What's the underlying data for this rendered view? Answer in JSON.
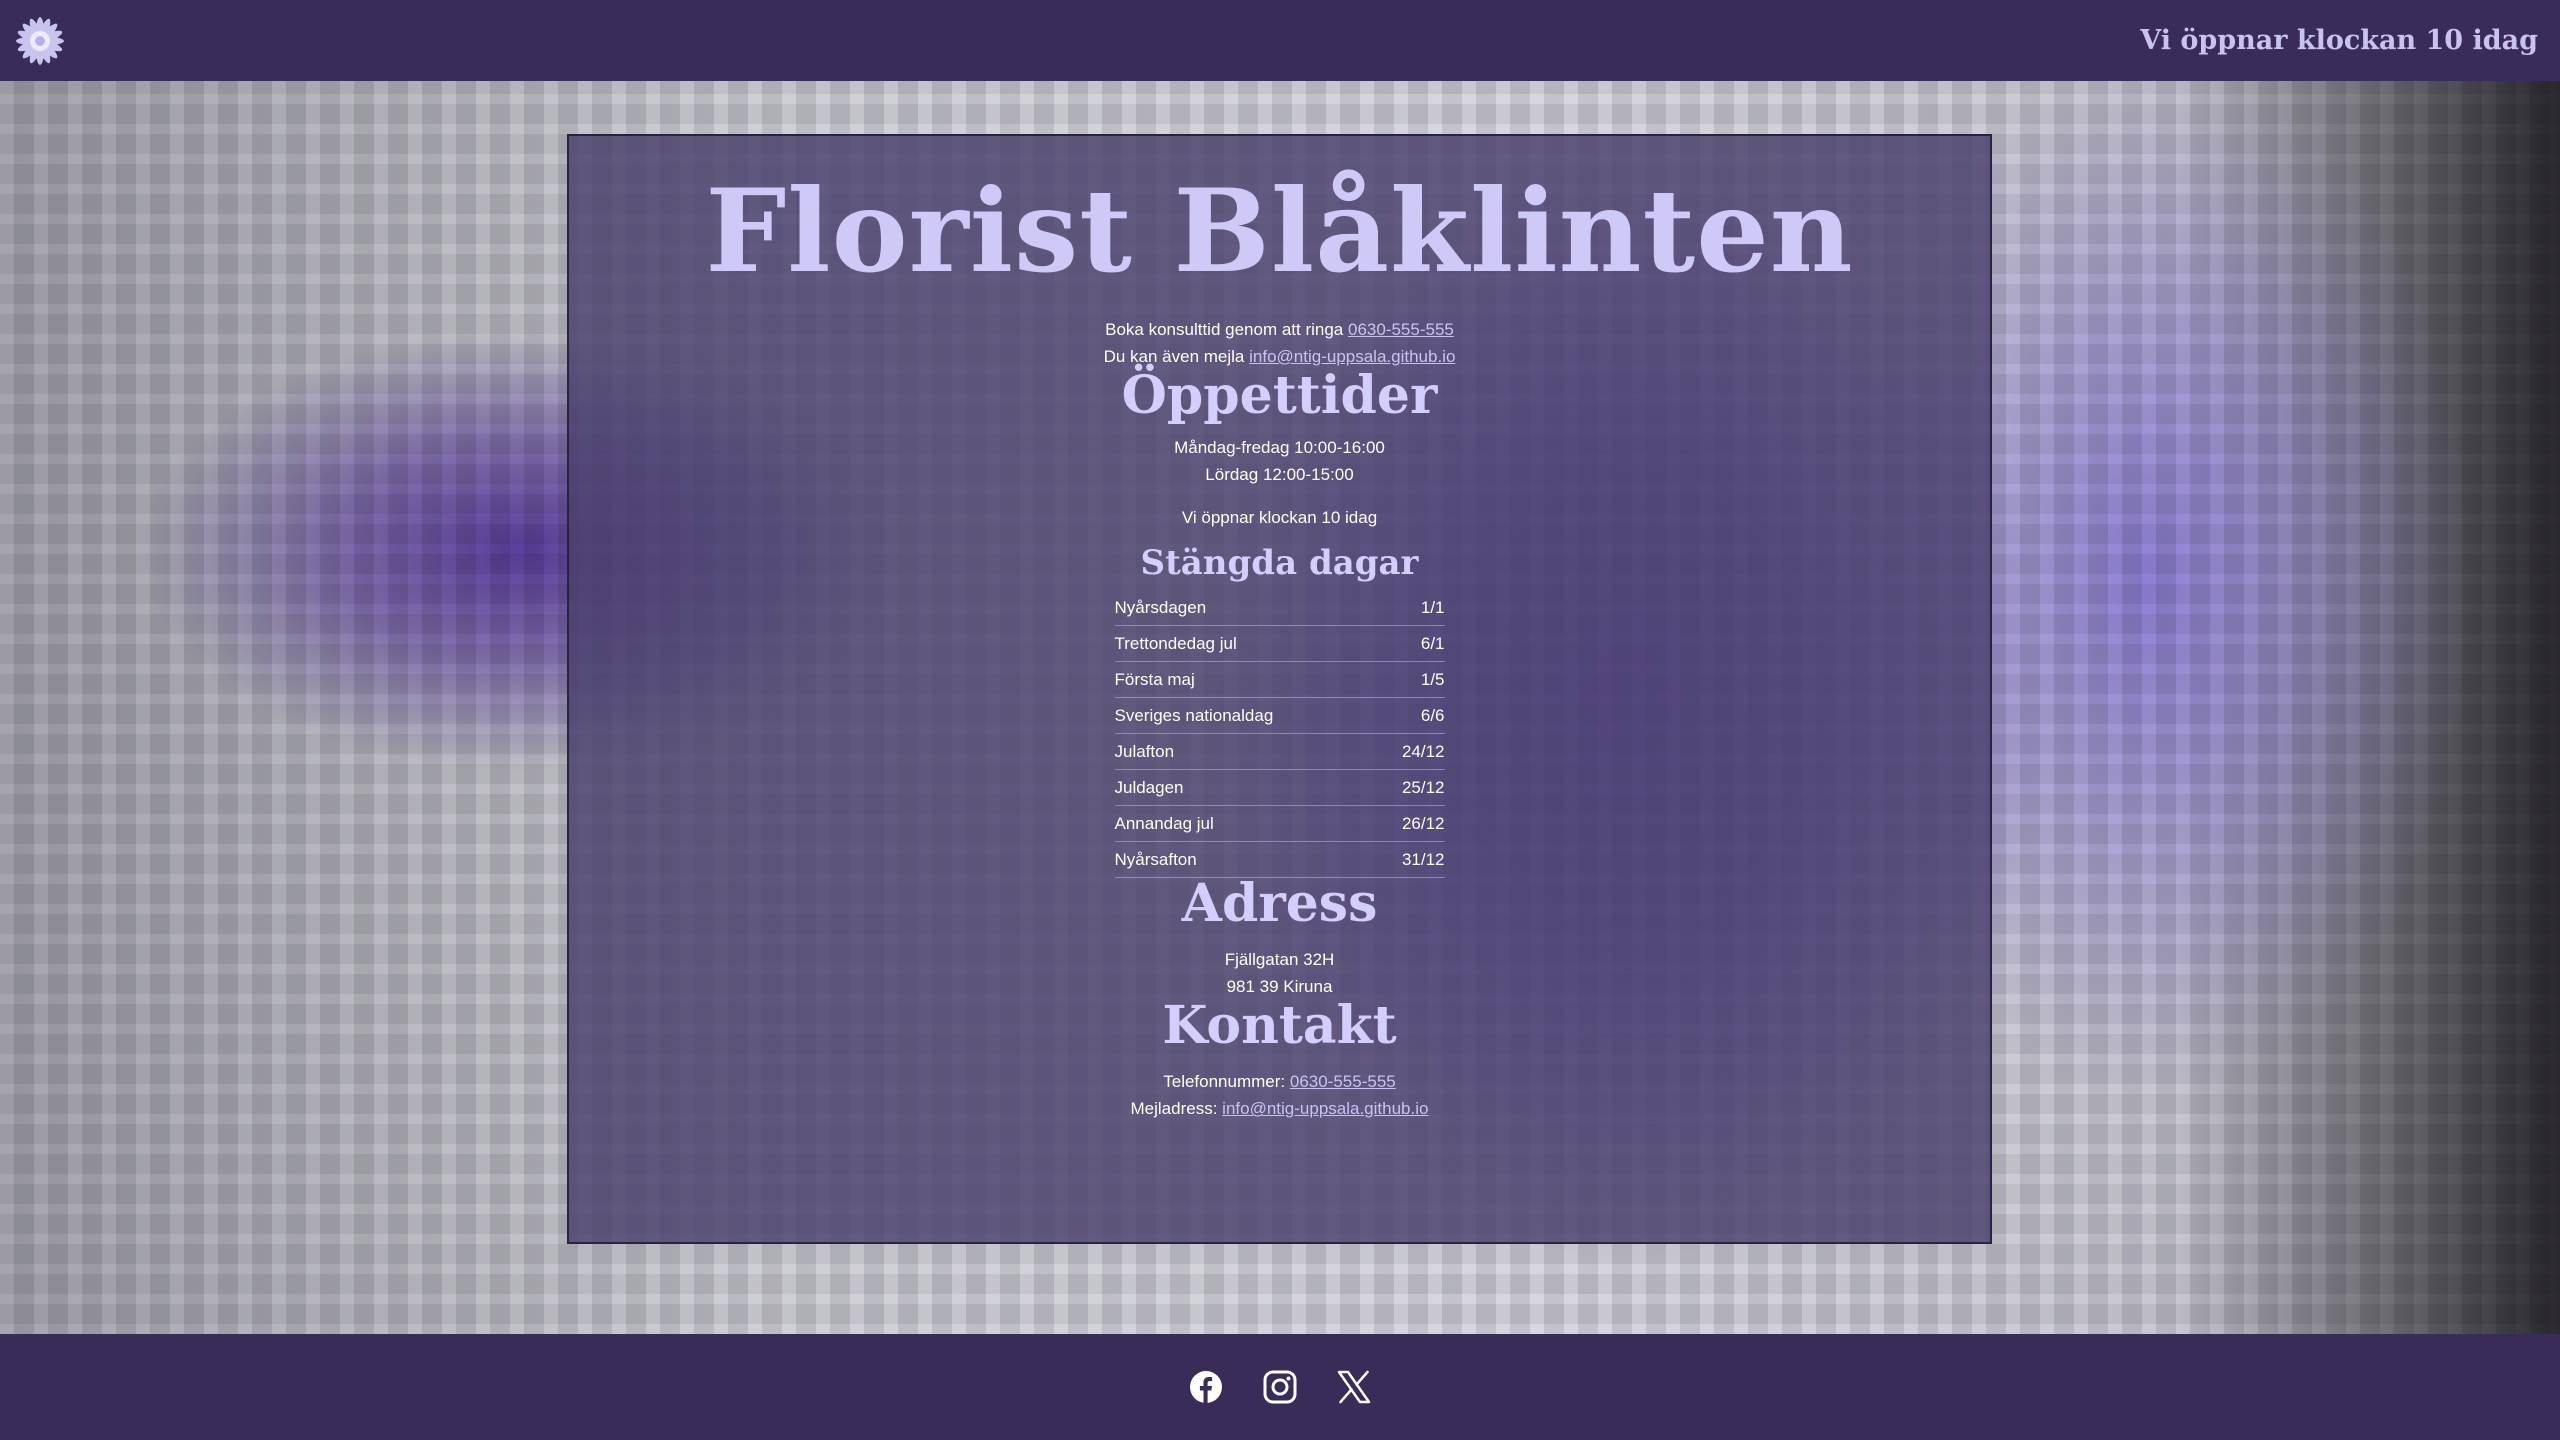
{
  "header": {
    "logo_icon": "flower-logo-icon",
    "status_text": "Vi öppnar klockan 10 idag"
  },
  "main": {
    "title": "Florist Blåklinten",
    "booking": {
      "prefix": "Boka konsulttid genom att ringa",
      "phone": "0630-555-555",
      "email_prefix": "Du kan även mejla",
      "email": "info@ntig-uppsala.github.io"
    },
    "hours": {
      "heading": "Öppettider",
      "weekday": "Måndag-fredag 10:00-16:00",
      "saturday": "Lördag 12:00-15:00",
      "today": "Vi öppnar klockan 10 idag"
    },
    "closed": {
      "heading": "Stängda dagar",
      "days": [
        {
          "name": "Nyårsdagen",
          "date": "1/1"
        },
        {
          "name": "Trettondedag jul",
          "date": "6/1"
        },
        {
          "name": "Första maj",
          "date": "1/5"
        },
        {
          "name": "Sveriges nationaldag",
          "date": "6/6"
        },
        {
          "name": "Julafton",
          "date": "24/12"
        },
        {
          "name": "Juldagen",
          "date": "25/12"
        },
        {
          "name": "Annandag jul",
          "date": "26/12"
        },
        {
          "name": "Nyårsafton",
          "date": "31/12"
        }
      ]
    },
    "address": {
      "heading": "Adress",
      "street": "Fjällgatan 32H",
      "city": "981 39 Kiruna"
    },
    "contact": {
      "heading": "Kontakt",
      "phone_label": "Telefonnummer:",
      "phone": "0630-555-555",
      "email_label": "Mejladress:",
      "email": "info@ntig-uppsala.github.io"
    }
  },
  "footer": {
    "social": [
      "facebook-icon",
      "instagram-icon",
      "x-icon"
    ]
  },
  "colors": {
    "bar": "#3a2c58",
    "accent": "#cfc9f7",
    "link": "#c9c3f4"
  }
}
